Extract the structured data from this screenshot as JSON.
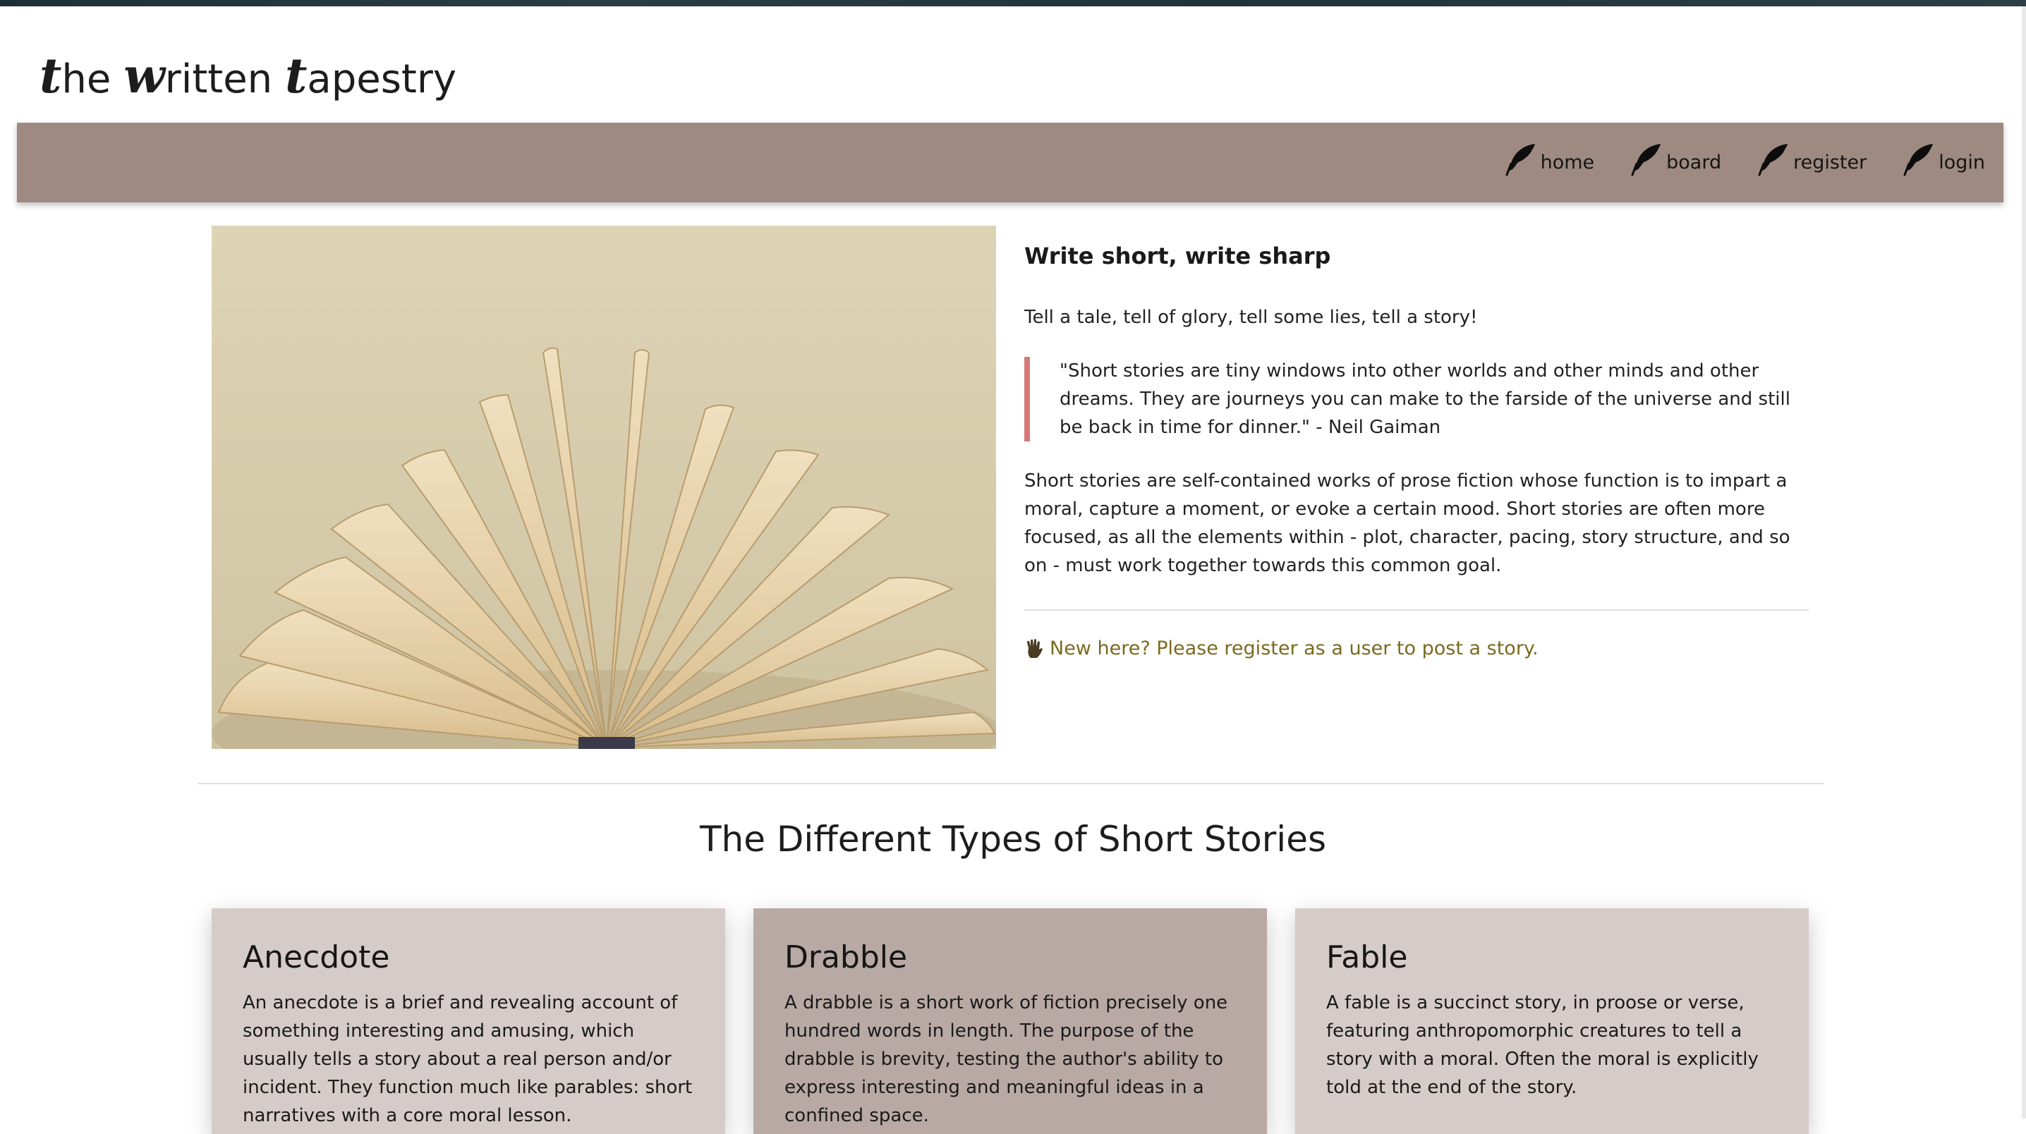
{
  "brand": {
    "part1_cap": "t",
    "part1_rest": "he",
    "part2_cap": "w",
    "part2_rest": "ritten",
    "part3_cap": "t",
    "part3_rest": "apestry"
  },
  "nav": {
    "items": [
      {
        "label": "home",
        "icon": "quill-icon"
      },
      {
        "label": "board",
        "icon": "quill-icon"
      },
      {
        "label": "register",
        "icon": "quill-icon"
      },
      {
        "label": "login",
        "icon": "quill-icon"
      }
    ]
  },
  "hero": {
    "title": "Write short, write sharp",
    "subtitle": "Tell a tale, tell of glory, tell some lies, tell a story!",
    "quote": "\"Short stories are tiny windows into other worlds and other minds and other dreams. They are journeys you can make to the farside of the universe and still be back in time for dinner.\" - Neil Gaiman",
    "body": "Short stories are self-contained works of prose fiction whose function is to impart a moral, capture a moment, or evoke a certain mood. Short stories are often more focused, as all the elements within - plot, character, pacing, story structure, and so on - must work together towards this common goal.",
    "register_text": "New here? Please register as a user to post a story.",
    "register_icon": "hand-icon",
    "image": "open-book-image"
  },
  "types_section": {
    "title": "The Different Types of Short Stories",
    "cards": [
      {
        "title": "Anecdote",
        "text": "An anecdote is a brief and revealing account of something interesting and amusing, which usually tells a story about a real person and/or incident. They function much like parables: short narratives with a core moral lesson."
      },
      {
        "title": "Drabble",
        "text": "A drabble is a short work of fiction precisely one hundred words in length. The purpose of the drabble is brevity, testing the author's ability to express interesting and meaningful ideas in a confined space."
      },
      {
        "title": "Fable",
        "text": "A fable is a succinct story, in proose or verse, featuring anthropomorphic creatures to tell a story with a moral. Often the moral is explicitly told at the end of the story."
      }
    ]
  },
  "colors": {
    "navbar": "#9e8a81",
    "quote_border": "#d77879",
    "link": "#7a6a1e",
    "card_light": "#d5cbc9",
    "card_dark": "#b9a9a5"
  }
}
